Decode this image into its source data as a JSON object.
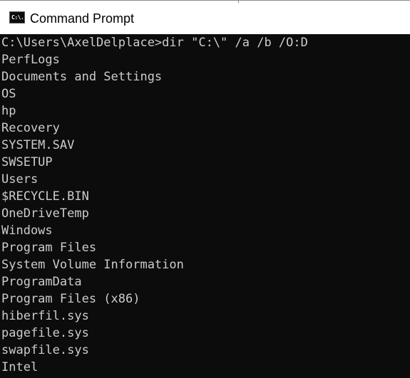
{
  "window": {
    "title": "Command Prompt",
    "icon": "cmd-icon",
    "icon_text": "C:\\."
  },
  "console": {
    "lines": [
      "C:\\Users\\AxelDelplace>dir \"C:\\\" /a /b /O:D",
      "PerfLogs",
      "Documents and Settings",
      "OS",
      "hp",
      "Recovery",
      "SYSTEM.SAV",
      "SWSETUP",
      "Users",
      "$RECYCLE.BIN",
      "OneDriveTemp",
      "Windows",
      "Program Files",
      "System Volume Information",
      "ProgramData",
      "Program Files (x86)",
      "hiberfil.sys",
      "pagefile.sys",
      "swapfile.sys",
      "Intel"
    ],
    "background": "#0c0c0c",
    "foreground": "#cccccc"
  }
}
